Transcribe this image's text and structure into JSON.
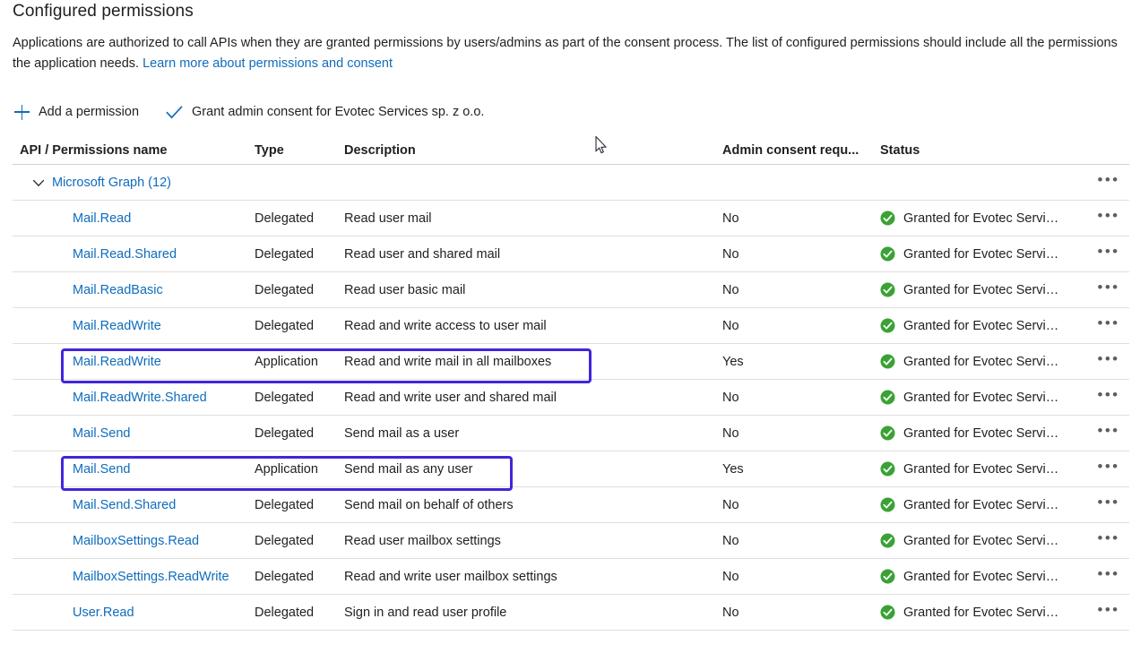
{
  "page": {
    "title": "Configured permissions",
    "intro_text_1": "Applications are authorized to call APIs when they are granted permissions by users/admins as part of the consent process. The list of configured permissions should include all the permissions the application needs. ",
    "intro_link": "Learn more about permissions and consent"
  },
  "commandbar": {
    "add_permission_label": "Add a permission",
    "grant_consent_label": "Grant admin consent for Evotec Services sp. z o.o.",
    "add_icon": "plus-icon",
    "grant_icon": "checkmark-icon"
  },
  "table": {
    "headers": {
      "name": "API / Permissions name",
      "type": "Type",
      "description": "Description",
      "admin_consent": "Admin consent requ...",
      "status": "Status"
    },
    "group": {
      "label": "Microsoft Graph (12)",
      "chevron": "chevron-down-icon",
      "more": "•••"
    },
    "more_glyph": "•••",
    "rows": [
      {
        "name": "Mail.Read",
        "type": "Delegated",
        "description": "Read user mail",
        "admin_consent": "No",
        "status": "Granted for Evotec Servi…",
        "status_icon": "granted-check-icon",
        "highlighted": false
      },
      {
        "name": "Mail.Read.Shared",
        "type": "Delegated",
        "description": "Read user and shared mail",
        "admin_consent": "No",
        "status": "Granted for Evotec Servi…",
        "status_icon": "granted-check-icon",
        "highlighted": false
      },
      {
        "name": "Mail.ReadBasic",
        "type": "Delegated",
        "description": "Read user basic mail",
        "admin_consent": "No",
        "status": "Granted for Evotec Servi…",
        "status_icon": "granted-check-icon",
        "highlighted": false
      },
      {
        "name": "Mail.ReadWrite",
        "type": "Delegated",
        "description": "Read and write access to user mail",
        "admin_consent": "No",
        "status": "Granted for Evotec Servi…",
        "status_icon": "granted-check-icon",
        "highlighted": false
      },
      {
        "name": "Mail.ReadWrite",
        "type": "Application",
        "description": "Read and write mail in all mailboxes",
        "admin_consent": "Yes",
        "status": "Granted for Evotec Servi…",
        "status_icon": "granted-check-icon",
        "highlighted": true
      },
      {
        "name": "Mail.ReadWrite.Shared",
        "type": "Delegated",
        "description": "Read and write user and shared mail",
        "admin_consent": "No",
        "status": "Granted for Evotec Servi…",
        "status_icon": "granted-check-icon",
        "highlighted": false
      },
      {
        "name": "Mail.Send",
        "type": "Delegated",
        "description": "Send mail as a user",
        "admin_consent": "No",
        "status": "Granted for Evotec Servi…",
        "status_icon": "granted-check-icon",
        "highlighted": false
      },
      {
        "name": "Mail.Send",
        "type": "Application",
        "description": "Send mail as any user",
        "admin_consent": "Yes",
        "status": "Granted for Evotec Servi…",
        "status_icon": "granted-check-icon",
        "highlighted": true
      },
      {
        "name": "Mail.Send.Shared",
        "type": "Delegated",
        "description": "Send mail on behalf of others",
        "admin_consent": "No",
        "status": "Granted for Evotec Servi…",
        "status_icon": "granted-check-icon",
        "highlighted": false
      },
      {
        "name": "MailboxSettings.Read",
        "type": "Delegated",
        "description": "Read user mailbox settings",
        "admin_consent": "No",
        "status": "Granted for Evotec Servi…",
        "status_icon": "granted-check-icon",
        "highlighted": false
      },
      {
        "name": "MailboxSettings.ReadWrite",
        "type": "Delegated",
        "description": "Read and write user mailbox settings",
        "admin_consent": "No",
        "status": "Granted for Evotec Servi…",
        "status_icon": "granted-check-icon",
        "highlighted": false
      },
      {
        "name": "User.Read",
        "type": "Delegated",
        "description": "Sign in and read user profile",
        "admin_consent": "No",
        "status": "Granted for Evotec Servi…",
        "status_icon": "granted-check-icon",
        "highlighted": false
      }
    ]
  },
  "colors": {
    "link": "#0f6cbd",
    "highlight_box": "#4026dc",
    "granted_green": "#3aa234",
    "row_divider": "#e1dfdd",
    "text": "#201f1e"
  }
}
